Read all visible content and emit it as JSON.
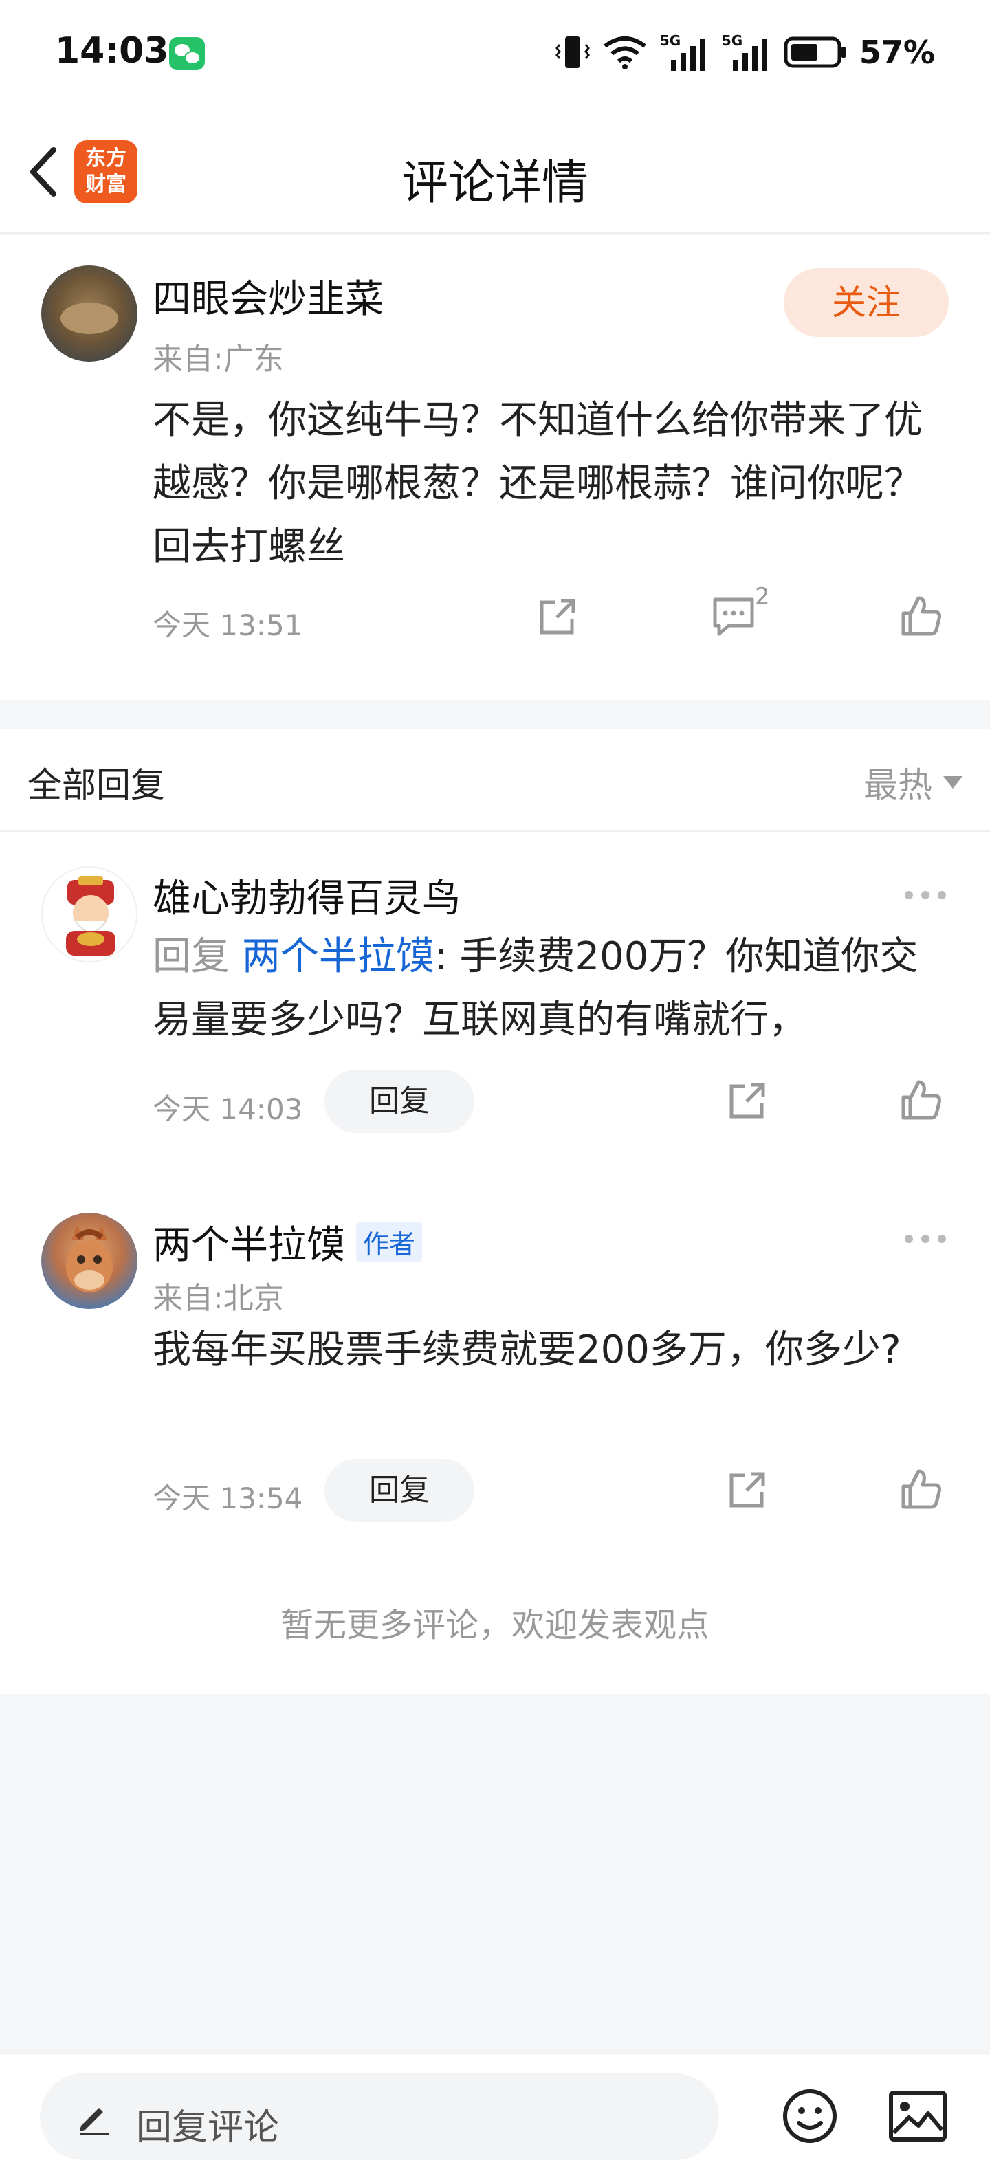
{
  "status_bar": {
    "time": "14:03",
    "battery": "57%",
    "network_1": "5G",
    "network_2": "5G"
  },
  "nav": {
    "title": "评论详情",
    "logo_line1": "东方",
    "logo_line2": "财富"
  },
  "main_comment": {
    "username": "四眼会炒韭菜",
    "source": "来自:广东",
    "follow_label": "关注",
    "content": "不是，你这纯牛马？不知道什么给你带来了优越感？你是哪根葱？还是哪根蒜？谁问你呢？回去打螺丝",
    "time": "今天 13:51",
    "comment_count": "2"
  },
  "replies_section": {
    "header": "全部回复",
    "sort_label": "最热",
    "replies": [
      {
        "username": "雄心勃勃得百灵鸟",
        "reply_label": "回复",
        "reply_to": "两个半拉馍",
        "content": ": 手续费200万？你知道你交易量要多少吗？互联网真的有嘴就行，",
        "time": "今天 14:03",
        "reply_button": "回复"
      },
      {
        "username": "两个半拉馍",
        "badge": "作者",
        "source": "来自:北京",
        "content": "我每年买股票手续费就要200多万，你多少?",
        "time": "今天 13:54",
        "reply_button": "回复"
      }
    ],
    "end_text": "暂无更多评论，欢迎发表观点"
  },
  "bottom_bar": {
    "placeholder": "回复评论"
  },
  "colors": {
    "accent": "#e85b10",
    "link": "#1766d6",
    "brand": "#ef5a1f"
  }
}
